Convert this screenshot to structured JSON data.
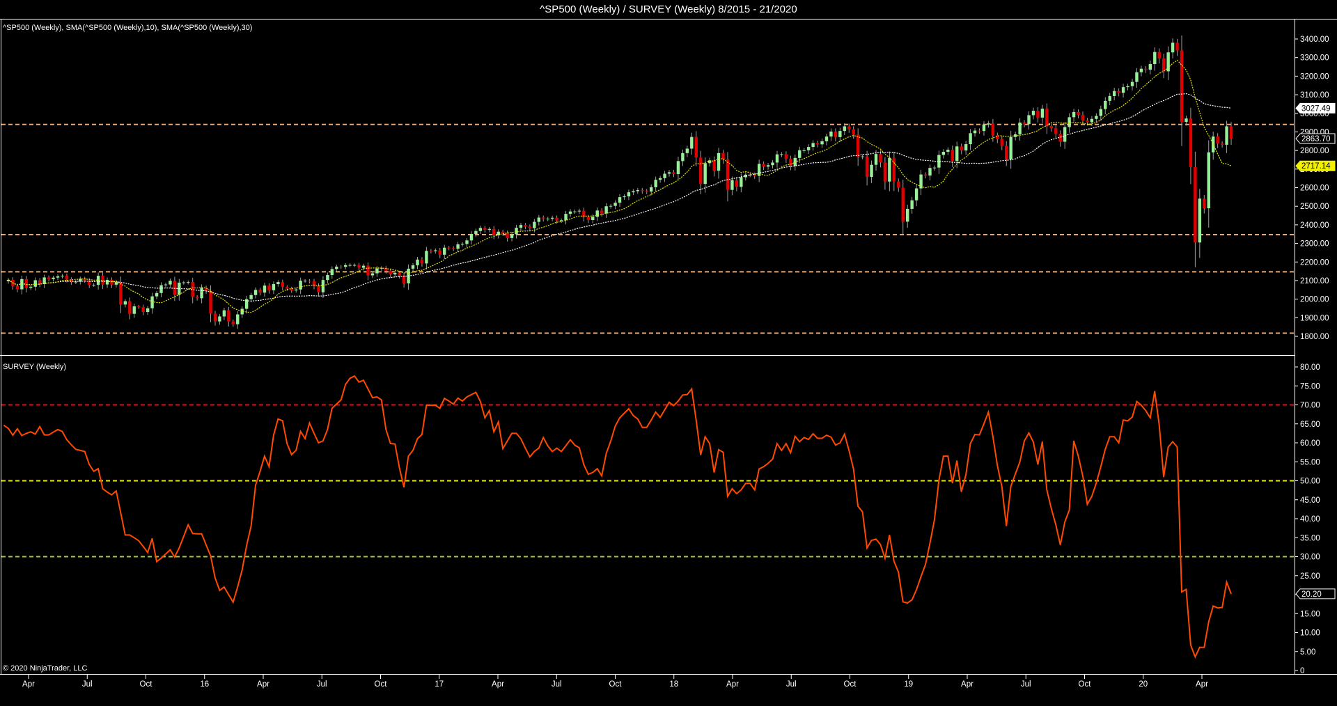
{
  "window_title": "^SP500 (Weekly) / SURVEY (Weekly)  8/2015 - 21/2020",
  "copyright": "© 2020 NinjaTrader, LLC",
  "colors": {
    "up": "#98f098",
    "down": "#e00000",
    "wick": "#a0a0a0",
    "sma10": "#e8e800",
    "sma30": "#ffffff",
    "survey": "#ff4a00",
    "level": "#e8a878",
    "survey_70": "#e01010",
    "survey_50": "#e8e800",
    "survey_30": "#a8c830"
  },
  "chart_data": [
    {
      "type": "candlestick",
      "title": "^SP500 (Weekly), SMA(^SP500 (Weekly),10), SMA(^SP500 (Weekly),30)",
      "ylim": [
        1740,
        3480
      ],
      "y_ticks": [
        "3400.00",
        "3300.00",
        "3200.00",
        "3100.00",
        "3000.00",
        "2900.00",
        "2800.00",
        "2700.00",
        "2600.00",
        "2500.00",
        "2400.00",
        "2300.00",
        "2200.00",
        "2100.00",
        "2000.00",
        "1900.00",
        "1800.00"
      ],
      "y_tick_values": [
        3400,
        3300,
        3200,
        3100,
        3000,
        2900,
        2800,
        2700,
        2600,
        2500,
        2400,
        2300,
        2200,
        2100,
        2000,
        1900,
        1800
      ],
      "sma_periods": [
        10,
        30
      ],
      "horizontal_levels": [
        2940,
        2347,
        2147,
        1817
      ],
      "price_labels": {
        "sma30": "3027.49",
        "last": "2863.70",
        "sma10": "2717.14"
      },
      "weekly_close": [
        2104,
        2071,
        2053,
        2108,
        2061,
        2067,
        2102,
        2081,
        2117,
        2108,
        2116,
        2123,
        2126,
        2107,
        2092,
        2094,
        2110,
        2101,
        2077,
        2077,
        2126,
        2079,
        2104,
        2078,
        2092,
        1971,
        1989,
        1921,
        1961,
        1958,
        1931,
        1951,
        2015,
        2033,
        2075,
        2079,
        2099,
        2023,
        2089,
        2090,
        2092,
        2012,
        2005,
        2061,
        2044,
        1922,
        1880,
        1907,
        1940,
        1880,
        1865,
        1918,
        1948,
        2000,
        2022,
        2050,
        2035,
        2073,
        2048,
        2081,
        2092,
        2065,
        2057,
        2047,
        2052,
        2099,
        2099,
        2096,
        2071,
        2037,
        2103,
        2130,
        2162,
        2175,
        2174,
        2183,
        2184,
        2184,
        2169,
        2180,
        2128,
        2139,
        2165,
        2168,
        2153,
        2133,
        2141,
        2126,
        2085,
        2164,
        2182,
        2213,
        2192,
        2260,
        2258,
        2263,
        2239,
        2277,
        2275,
        2271,
        2295,
        2297,
        2316,
        2351,
        2367,
        2383,
        2373,
        2378,
        2344,
        2363,
        2355,
        2329,
        2349,
        2384,
        2399,
        2391,
        2382,
        2416,
        2439,
        2432,
        2433,
        2438,
        2423,
        2425,
        2459,
        2472,
        2472,
        2476,
        2441,
        2426,
        2443,
        2477,
        2461,
        2500,
        2502,
        2519,
        2549,
        2553,
        2575,
        2581,
        2587,
        2582,
        2579,
        2602,
        2642,
        2651,
        2675,
        2683,
        2673,
        2743,
        2786,
        2810,
        2873,
        2762,
        2620,
        2732,
        2747,
        2691,
        2786,
        2752,
        2588,
        2640,
        2604,
        2656,
        2670,
        2670,
        2663,
        2728,
        2713,
        2721,
        2735,
        2779,
        2780,
        2755,
        2718,
        2760,
        2801,
        2801,
        2819,
        2840,
        2833,
        2850,
        2875,
        2902,
        2872,
        2905,
        2930,
        2914,
        2886,
        2767,
        2768,
        2658,
        2723,
        2781,
        2736,
        2633,
        2760,
        2633,
        2600,
        2417,
        2486,
        2532,
        2596,
        2671,
        2665,
        2706,
        2708,
        2776,
        2793,
        2804,
        2743,
        2822,
        2800,
        2834,
        2893,
        2907,
        2905,
        2940,
        2946,
        2881,
        2860,
        2826,
        2752,
        2873,
        2887,
        2950,
        2942,
        2990,
        3014,
        2977,
        3025,
        2932,
        2919,
        2889,
        2847,
        2926,
        2979,
        3007,
        2992,
        2962,
        2952,
        2970,
        2986,
        3023,
        3067,
        3093,
        3120,
        3110,
        3141,
        3146,
        3169,
        3221,
        3240,
        3235,
        3265,
        3330,
        3295,
        3226,
        3328,
        3380,
        3338,
        2954,
        2972,
        2711,
        2305,
        2541,
        2489,
        2790,
        2875,
        2837,
        2831,
        2930,
        2864
      ]
    },
    {
      "type": "line",
      "title": "SURVEY (Weekly)",
      "ylim": [
        -2,
        83
      ],
      "y_ticks": [
        "80.00",
        "75.00",
        "70.00",
        "65.00",
        "60.00",
        "55.00",
        "50.00",
        "45.00",
        "40.00",
        "35.00",
        "30.00",
        "25.00",
        "20.00",
        "15.00",
        "10.00",
        "5.00",
        "0"
      ],
      "y_tick_values": [
        80,
        75,
        70,
        65,
        60,
        55,
        50,
        45,
        40,
        35,
        30,
        25,
        20,
        15,
        10,
        5,
        0
      ],
      "horizontal_levels": [
        70,
        50,
        30
      ],
      "last_label": "20.20",
      "values": [
        64.6,
        63.8,
        62,
        63.7,
        61.9,
        62.5,
        62.9,
        62.3,
        64.3,
        62.1,
        62.1,
        62.8,
        63.5,
        63,
        60.8,
        59.5,
        58.3,
        58,
        57.7,
        54.3,
        52.5,
        53.2,
        47.9,
        47,
        46.3,
        47.3,
        41.5,
        35.7,
        35.7,
        35,
        34.2,
        32.7,
        31.1,
        34.8,
        28.7,
        29.6,
        30.7,
        31.8,
        29.9,
        32.3,
        35.3,
        38.4,
        36.1,
        36,
        36,
        33.1,
        30.2,
        24.4,
        21.1,
        22,
        20,
        18,
        22,
        26.5,
        32.9,
        38.1,
        48.8,
        52.5,
        56.5,
        53.7,
        62,
        66.3,
        65.8,
        59.8,
        56.9,
        58,
        63,
        61.1,
        65.2,
        62.5,
        60,
        60.5,
        63.5,
        69.1,
        70.2,
        71.3,
        75.4,
        77,
        77.6,
        76,
        76.5,
        74.2,
        71.9,
        72.1,
        71.3,
        63.5,
        59.8,
        59.7,
        53.4,
        48.3,
        56.5,
        58,
        61.1,
        62.2,
        69.9,
        69.9,
        69.9,
        69.1,
        71.7,
        71,
        70.2,
        71.8,
        71,
        72.1,
        72.7,
        73.3,
        70.9,
        66.6,
        68.5,
        62.9,
        65.5,
        58.5,
        60.5,
        62.5,
        62.5,
        61.1,
        58.6,
        56.3,
        57.7,
        58.6,
        61.4,
        59.2,
        57.7,
        58.6,
        57.7,
        59.2,
        60.8,
        59.4,
        58.7,
        54.3,
        51.7,
        52.2,
        53.2,
        51.3,
        57.2,
        60.5,
        64.4,
        66.6,
        67.8,
        69,
        67.2,
        66.3,
        64.1,
        64.1,
        66,
        68.1,
        66.7,
        68.7,
        70.7,
        69.8,
        71,
        72.6,
        72.7,
        74.2,
        66,
        56.8,
        61.6,
        59.8,
        52.2,
        58.2,
        57.5,
        45.9,
        47.9,
        46.6,
        47.6,
        49.3,
        49.3,
        47.6,
        53.1,
        53.7,
        54.6,
        55.7,
        59.8,
        58,
        59.8,
        57.4,
        61.7,
        60.3,
        61.4,
        60.9,
        62.4,
        61.2,
        61.2,
        62,
        61.5,
        59.4,
        60,
        62.3,
        58,
        53.1,
        43.3,
        41.8,
        32.3,
        34.3,
        34.6,
        33.2,
        29.6,
        35.7,
        28.8,
        25.9,
        18.1,
        17.8,
        18.6,
        21.3,
        24.7,
        27.9,
        33.5,
        39.7,
        50.1,
        56.5,
        56.5,
        49.4,
        55.3,
        47.1,
        51.6,
        59.8,
        62.2,
        62.1,
        65,
        68.1,
        61.7,
        54,
        48.5,
        38.1,
        48.5,
        51.8,
        55,
        60.5,
        62.6,
        60.2,
        54.3,
        60.3,
        47.6,
        42.7,
        38.4,
        33.1,
        39.1,
        42.3,
        60.5,
        56.5,
        51.3,
        43.8,
        45.9,
        49.4,
        53.7,
        58.3,
        61.6,
        61.6,
        60,
        66,
        65.8,
        66.8,
        70.9,
        69.9,
        68.5,
        66.6,
        73.6,
        64.7,
        51,
        58.9,
        60.3,
        58.9,
        20.7,
        21.4,
        6.7,
        3.6,
        6.1,
        6.1,
        12.8,
        17,
        16.5,
        16.6,
        23.3,
        20.2
      ]
    }
  ],
  "x_axis": {
    "labels": [
      "Apr",
      "Jul",
      "Oct",
      "16",
      "Apr",
      "Jul",
      "Oct",
      "17",
      "Apr",
      "Jul",
      "Oct",
      "18",
      "Apr",
      "Jul",
      "Oct",
      "19",
      "Apr",
      "Jul",
      "Oct",
      "20",
      "Apr"
    ]
  }
}
